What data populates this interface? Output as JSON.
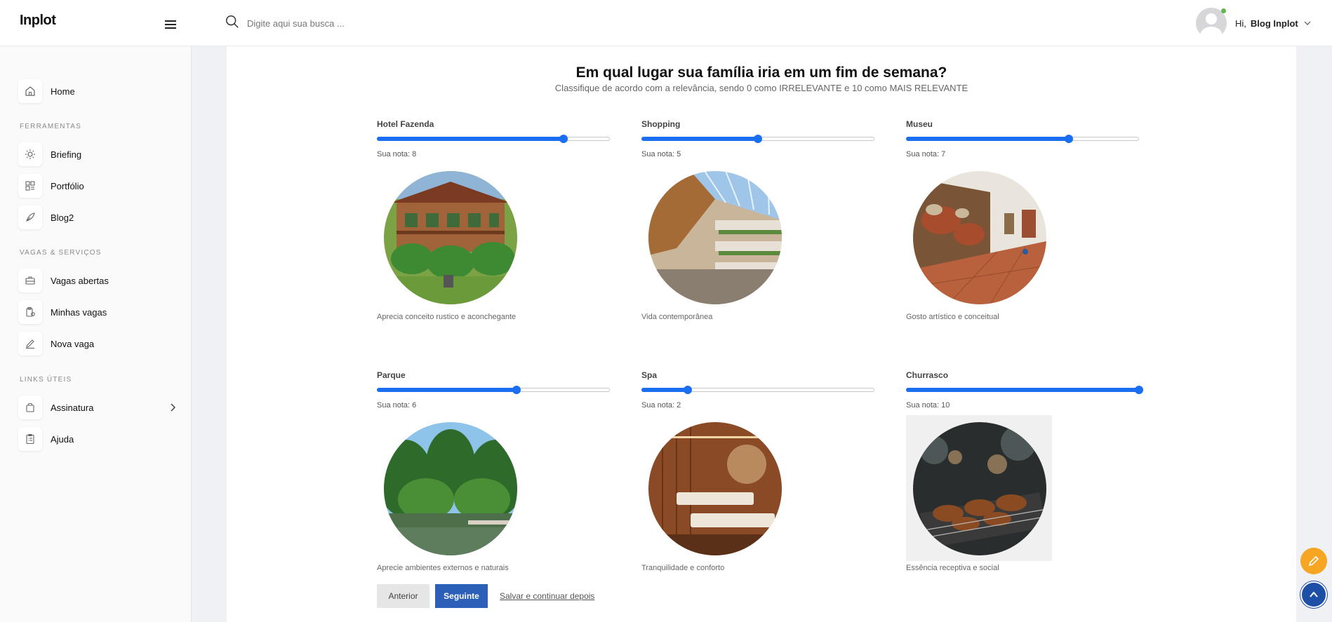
{
  "header": {
    "logo_text": "Inplot",
    "search_placeholder": "Digite aqui sua busca ...",
    "user_greeting": "Hi,",
    "user_name": "Blog Inplot"
  },
  "sidebar": {
    "home_label": "Home",
    "sections": [
      "FERRAMENTAS",
      "VAGAS & SERVIÇOS",
      "LINKS ÚTEIS"
    ],
    "items": [
      {
        "label": "Briefing",
        "icon": "sun-icon"
      },
      {
        "label": "Portfólio",
        "icon": "grid-icon"
      },
      {
        "label": "Blog2",
        "icon": "feather-icon"
      },
      {
        "label": "Vagas abertas",
        "icon": "briefcase-icon"
      },
      {
        "label": "Minhas vagas",
        "icon": "clipboard-icon"
      },
      {
        "label": "Nova vaga",
        "icon": "pencil-icon"
      },
      {
        "label": "Assinatura",
        "icon": "bag-icon"
      },
      {
        "label": "Ajuda",
        "icon": "checklist-icon"
      }
    ]
  },
  "question": {
    "title": "Em qual lugar sua família iria em um fim de semana?",
    "subtitle": "Classifique de acordo com a relevância, sendo 0 como IRRELEVANTE e 10 como MAIS RELEVANTE"
  },
  "options": [
    {
      "label": "Hotel Fazenda",
      "score_text": "Sua nota: 8",
      "value": 8,
      "max": 10,
      "caption": "Aprecia conceito rustico e aconchegante"
    },
    {
      "label": "Shopping",
      "score_text": "Sua nota: 5",
      "value": 5,
      "max": 10,
      "caption": "Vida contemporânea"
    },
    {
      "label": "Museu",
      "score_text": "Sua nota: 7",
      "value": 7,
      "max": 10,
      "caption": "Gosto artístico e conceitual"
    },
    {
      "label": "Parque",
      "score_text": "Sua nota: 6",
      "value": 6,
      "max": 10,
      "caption": "Aprecie ambientes externos e naturais"
    },
    {
      "label": "Spa",
      "score_text": "Sua nota: 2",
      "value": 2,
      "max": 10,
      "caption": "Tranquilidade e conforto"
    },
    {
      "label": "Churrasco",
      "score_text": "Sua nota: 10",
      "value": 10,
      "max": 10,
      "caption": "Essência receptiva e social"
    }
  ],
  "actions": {
    "prev_label": "Anterior",
    "next_label": "Seguinte",
    "save_label": "Salvar e continuar depois"
  },
  "colors": {
    "accent": "#1a6ef2",
    "primary_button": "#2b5fb8",
    "fab_edit": "#f6a623",
    "fab_top": "#1d4fa6"
  }
}
